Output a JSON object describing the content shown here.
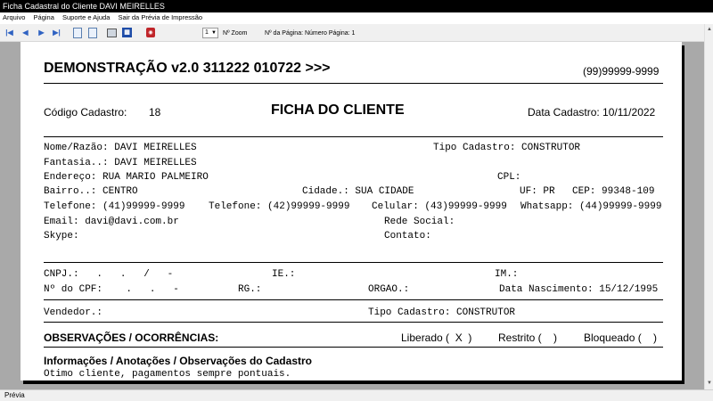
{
  "window": {
    "title": "Ficha Cadastral do Cliente DAVI MEIRELLES"
  },
  "menu": {
    "items": [
      "Arquivo",
      "Página",
      "Suporte e Ajuda",
      "Sair da Prévia de Impressão"
    ]
  },
  "toolbar": {
    "zoom_value": "1",
    "zoom_label": "Nº Zoom",
    "page_label": "Nº da Página: Número Página: 1"
  },
  "report": {
    "header_title": "DEMONSTRAÇÃO v2.0 311222 010722 >>>",
    "header_phone": "(99)99999-9999",
    "codigo_label": "Código Cadastro:",
    "codigo_value": "18",
    "ficha_title": "FICHA DO CLIENTE",
    "data_cadastro": "Data Cadastro: 10/11/2022",
    "nome": "Nome/Razão: DAVI MEIRELLES",
    "tipo_cadastro": "Tipo Cadastro: CONSTRUTOR",
    "fantasia": "Fantasia..: DAVI MEIRELLES",
    "endereco": "Endereço: RUA MARIO PALMEIRO",
    "cpl": "CPL:",
    "bairro": "Bairro..: CENTRO",
    "cidade": "Cidade.: SUA CIDADE",
    "uf": "UF: PR",
    "cep": "CEP: 99348-109",
    "telefone1": "Telefone: (41)99999-9999",
    "telefone2": "Telefone: (42)99999-9999",
    "celular": "Celular: (43)99999-9999",
    "whatsapp": "Whatsapp: (44)99999-9999",
    "email": "Email: davi@davi.com.br",
    "rede_social": "Rede Social:",
    "skype": "Skype:",
    "contato": "Contato:",
    "cnpj": "CNPJ.:   .   .   /   -",
    "ie": "IE.:",
    "im": "IM.:",
    "cpf": "Nº do CPF:    .   .   -",
    "rg": "RG.:",
    "orgao": "ORGAO.:",
    "data_nascimento": "Data Nascimento: 15/12/1995",
    "vendedor": "Vendedor.:",
    "tipo_cadastro_2": "Tipo Cadastro: CONSTRUTOR",
    "observacoes_title": "OBSERVAÇÕES / OCORRÊNCIAS:",
    "liberado": "Liberado (  X  )",
    "restrito": "Restrito (    )",
    "bloqueado": "Bloqueado (    )",
    "info_title": "Informações / Anotações / Observações do Cadastro",
    "info_text": "Otimo cliente, pagamentos sempre pontuais."
  },
  "status": {
    "text": "Prévia"
  }
}
